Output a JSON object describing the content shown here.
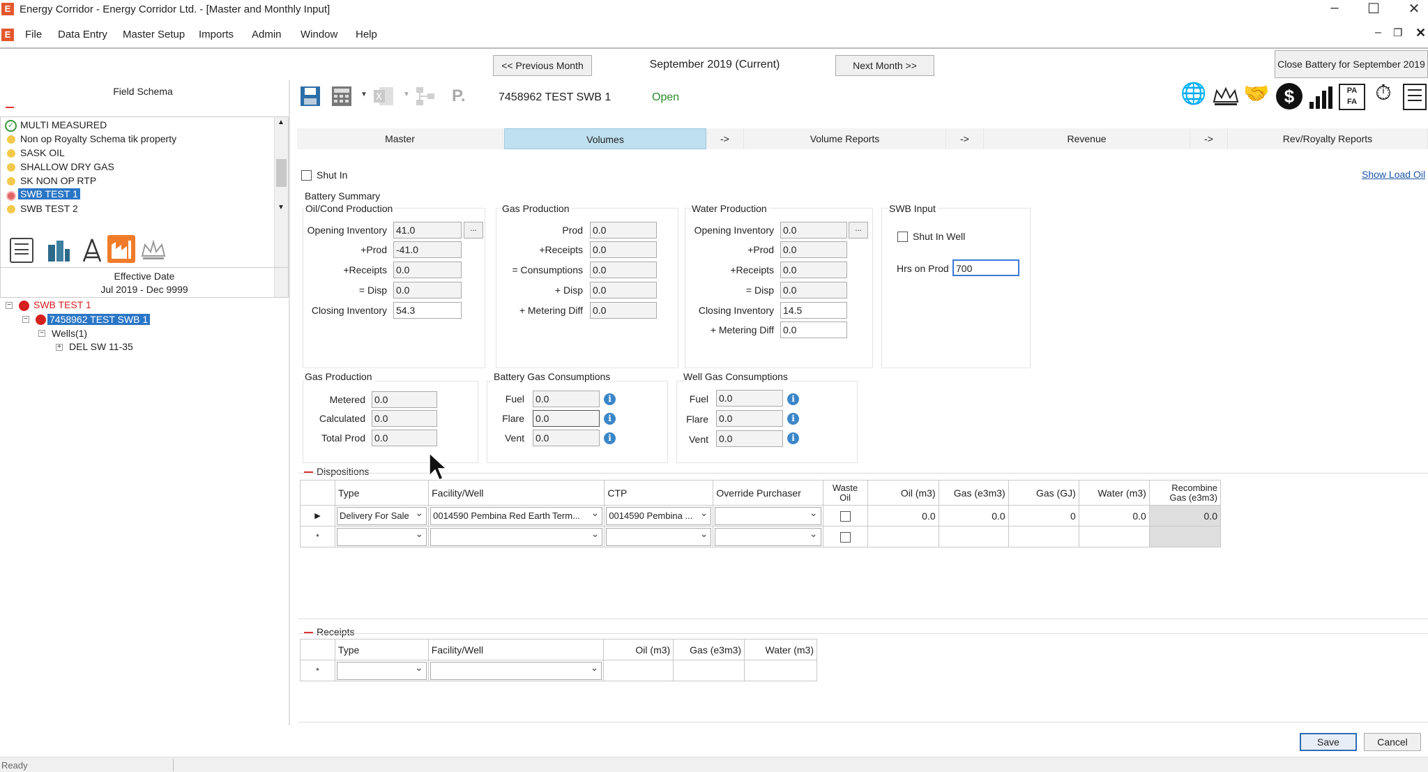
{
  "window": {
    "title": "Energy Corridor - Energy Corridor Ltd. - [Master and Monthly Input]",
    "logo": "E"
  },
  "menu": [
    "File",
    "Data Entry",
    "Master Setup",
    "Imports",
    "Admin",
    "Window",
    "Help"
  ],
  "nav": {
    "prev": "<<  Previous Month",
    "month": "September 2019 (Current)",
    "next": "Next Month  >>",
    "close_battery": "Close Battery for September 2019"
  },
  "left": {
    "schema_title": "Field Schema",
    "schema_items": [
      "MULTI MEASURED",
      "Non op Royalty Schema tik property",
      "SASK OIL",
      "SHALLOW DRY GAS",
      "SK NON OP RTP",
      "SWB TEST 1",
      "SWB TEST 2"
    ],
    "effective_label": "Effective Date",
    "effective_value": "Jul 2019 - Dec 9999",
    "tree": {
      "root": "SWB TEST 1",
      "battery": "7458962 TEST SWB 1",
      "wells": "Wells(1)",
      "well": "DEL SW 11-35"
    }
  },
  "header": {
    "battery_id": "7458962  TEST SWB 1",
    "status": "Open"
  },
  "tabs": [
    "Master",
    "Volumes",
    "->",
    "Volume Reports",
    "->",
    "Revenue",
    "->",
    "Rev/Royalty Reports"
  ],
  "shut_in_label": "Shut In",
  "show_load_oil": "Show Load Oil",
  "battery_summary": "Battery Summary",
  "oil": {
    "title": "Oil/Cond Production",
    "labels": [
      "Opening Inventory",
      "+Prod",
      "+Receipts",
      "= Disp",
      "Closing Inventory"
    ],
    "values": [
      "41.0",
      "-41.0",
      "0.0",
      "0.0",
      "54.3"
    ]
  },
  "gasprod": {
    "title": "Gas Production",
    "labels": [
      "Prod",
      "+Receipts",
      "= Consumptions",
      "+ Disp",
      "+ Metering Diff"
    ],
    "values": [
      "0.0",
      "0.0",
      "0.0",
      "0.0",
      "0.0"
    ]
  },
  "water": {
    "title": "Water Production",
    "labels": [
      "Opening Inventory",
      "+Prod",
      "+Receipts",
      "= Disp",
      "Closing Inventory",
      "+ Metering Diff"
    ],
    "values": [
      "0.0",
      "0.0",
      "0.0",
      "0.0",
      "14.5",
      "0.0"
    ]
  },
  "swb": {
    "title": "SWB Input",
    "shut_in_well": "Shut In Well",
    "hrs_label": "Hrs on Prod",
    "hrs_value": "700"
  },
  "gas2": {
    "title": "Gas Production",
    "labels": [
      "Metered",
      "Calculated",
      "Total Prod"
    ],
    "values": [
      "0.0",
      "0.0",
      "0.0"
    ]
  },
  "bgc": {
    "title": "Battery Gas Consumptions",
    "labels": [
      "Fuel",
      "Flare",
      "Vent"
    ],
    "values": [
      "0.0",
      "0.0",
      "0.0"
    ]
  },
  "wgc": {
    "title": "Well Gas Consumptions",
    "labels": [
      "Fuel",
      "Flare",
      "Vent"
    ],
    "values": [
      "0.0",
      "0.0",
      "0.0"
    ]
  },
  "dispositions": {
    "title": "Dispositions",
    "headers": [
      "Type",
      "Facility/Well",
      "CTP",
      "Override Purchaser",
      "Waste Oil",
      "Oil (m3)",
      "Gas (e3m3)",
      "Gas (GJ)",
      "Water (m3)",
      "Recombine Gas (e3m3)"
    ],
    "row": {
      "type": "Delivery For Sale",
      "facility": "0014590 Pembina Red Earth Term...",
      "ctp": "0014590 Pembina ...",
      "oil": "0.0",
      "gas": "0.0",
      "gj": "0",
      "water": "0.0",
      "recombine": "0.0"
    }
  },
  "receipts": {
    "title": "Receipts",
    "headers": [
      "Type",
      "Facility/Well",
      "Oil (m3)",
      "Gas (e3m3)",
      "Water (m3)"
    ]
  },
  "footer": {
    "save": "Save",
    "cancel": "Cancel",
    "status": "Ready"
  }
}
